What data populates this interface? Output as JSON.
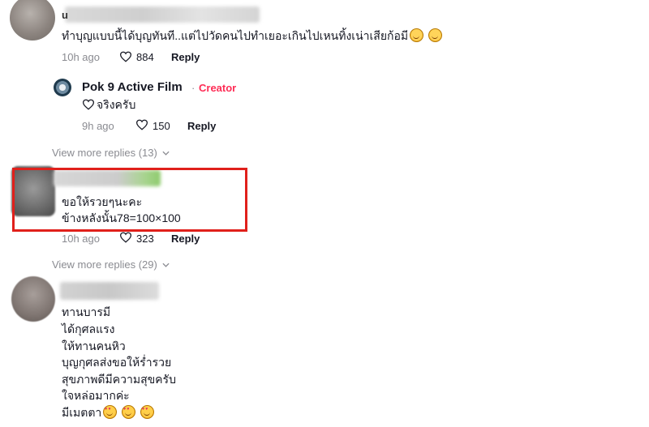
{
  "comments": [
    {
      "name_visible_char": "u",
      "text": "ทำบุญแบบนี้ได้บุญทันที..แต่ไปวัดคนไปทำเยอะเกินไปเหนทิ้งเน่าเสียก้อมี",
      "time": "10h ago",
      "likes": "884",
      "reply_label": "Reply"
    },
    {
      "text_line1": "ขอให้รวยๆนะคะ",
      "text_line2": "ข้างหลังนั้น78=100×100",
      "time": "10h ago",
      "likes": "323",
      "reply_label": "Reply",
      "highlighted": true,
      "highlight_color": "#e0201b"
    },
    {
      "lines": [
        "ทานบารมี",
        "ได้กุศลแรง",
        "ให้ทานคนหิว",
        "บุญกุศลส่งขอให้ร่ำรวย",
        "สุขภาพดีมีความสุขครับ",
        "ใจหล่อมากค่ะ",
        "มีเมตตา"
      ]
    }
  ],
  "creator_reply": {
    "name": "Pok 9 Active Film",
    "separator": "·",
    "tag": "Creator",
    "text": "จริงครับ",
    "time": "9h ago",
    "likes": "150",
    "reply_label": "Reply"
  },
  "view_more_1": "View more replies (13)",
  "view_more_2": "View more replies (29)",
  "colors": {
    "creator_tag": "#fe2c55",
    "muted": "#8a8b91",
    "text": "#161823"
  },
  "icons": [
    "heart-outline-icon",
    "chevron-down-icon",
    "smile-emoji-icon",
    "heart-eyes-emoji-icon"
  ]
}
